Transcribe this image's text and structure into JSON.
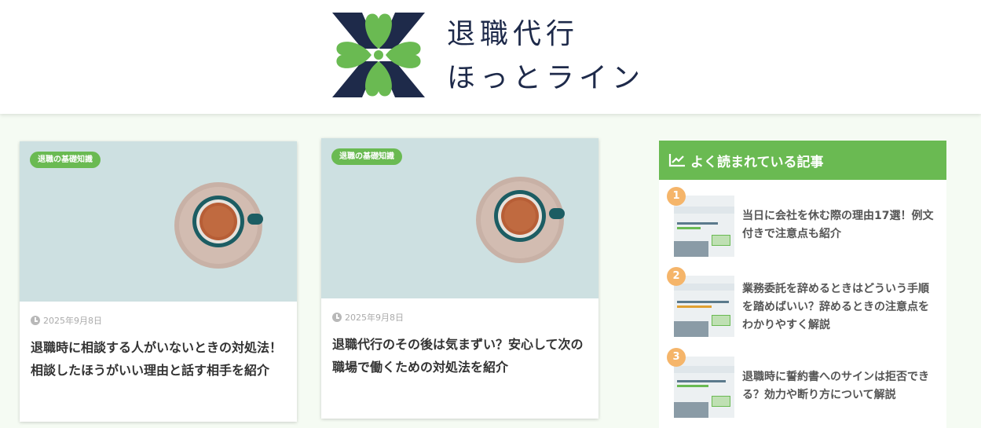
{
  "header": {
    "logo_line1": "退職代行",
    "logo_line2": "ほっとライン"
  },
  "colors": {
    "accent_green": "#6aba52",
    "navy": "#1e2a4a",
    "rank_orange": "#f5b56a"
  },
  "articles": [
    {
      "category": "退職の基礎知識",
      "date": "2025年9月8日",
      "title": "退職時に相談する人がいないときの対処法！相談したほうがいい理由と話す相手を紹介"
    },
    {
      "category": "退職の基礎知識",
      "date": "2025年9月8日",
      "title": "退職代行のその後は気まずい？安心して次の職場で働くための対処法を紹介"
    }
  ],
  "sidebar": {
    "heading": "よく読まれている記事",
    "heading_icon": "chart-line-icon",
    "ranking": [
      {
        "rank": "1",
        "title": "当日に会社を休む際の理由17選！例文付きで注意点も紹介"
      },
      {
        "rank": "2",
        "title": "業務委託を辞めるときはどういう手順を踏めばいい？辞めるときの注意点をわかりやすく解説"
      },
      {
        "rank": "3",
        "title": "退職時に誓約書へのサインは拒否できる？効力や断り方について解説"
      }
    ]
  }
}
